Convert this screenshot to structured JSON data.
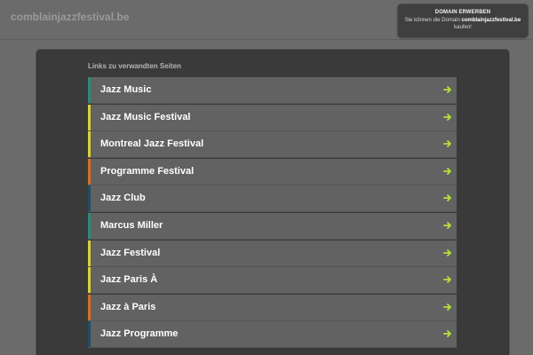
{
  "header": {
    "domain": "comblainjazzfestival.be"
  },
  "buy_box": {
    "title": "DOMAIN ERWERBEN",
    "text_before": "Sie können die Domain ",
    "domain": "comblainjazzfestival.be",
    "text_after": " kaufen!"
  },
  "links": {
    "heading": "Links zu verwandten Seiten",
    "arrow_icon": "arrow-right-icon",
    "arrow_color": "#b5e03a",
    "items": [
      {
        "label": "Jazz Music",
        "stripe_color": "#2e8a7a"
      },
      {
        "label": "Jazz Music Festival",
        "stripe_color": "#d8d23a"
      },
      {
        "label": "Montreal Jazz Festival",
        "stripe_color": "#d8d23a"
      },
      {
        "label": "Programme Festival",
        "stripe_color": "#d4702a"
      },
      {
        "label": "Jazz Club",
        "stripe_color": "#1e4f63"
      },
      {
        "label": "Marcus Miller",
        "stripe_color": "#2e8a7a"
      },
      {
        "label": "Jazz Festival",
        "stripe_color": "#d8d23a"
      },
      {
        "label": "Jazz Paris À",
        "stripe_color": "#d8d23a"
      },
      {
        "label": "Jazz à Paris",
        "stripe_color": "#d4702a"
      },
      {
        "label": "Jazz Programme",
        "stripe_color": "#1e4f63"
      }
    ]
  }
}
